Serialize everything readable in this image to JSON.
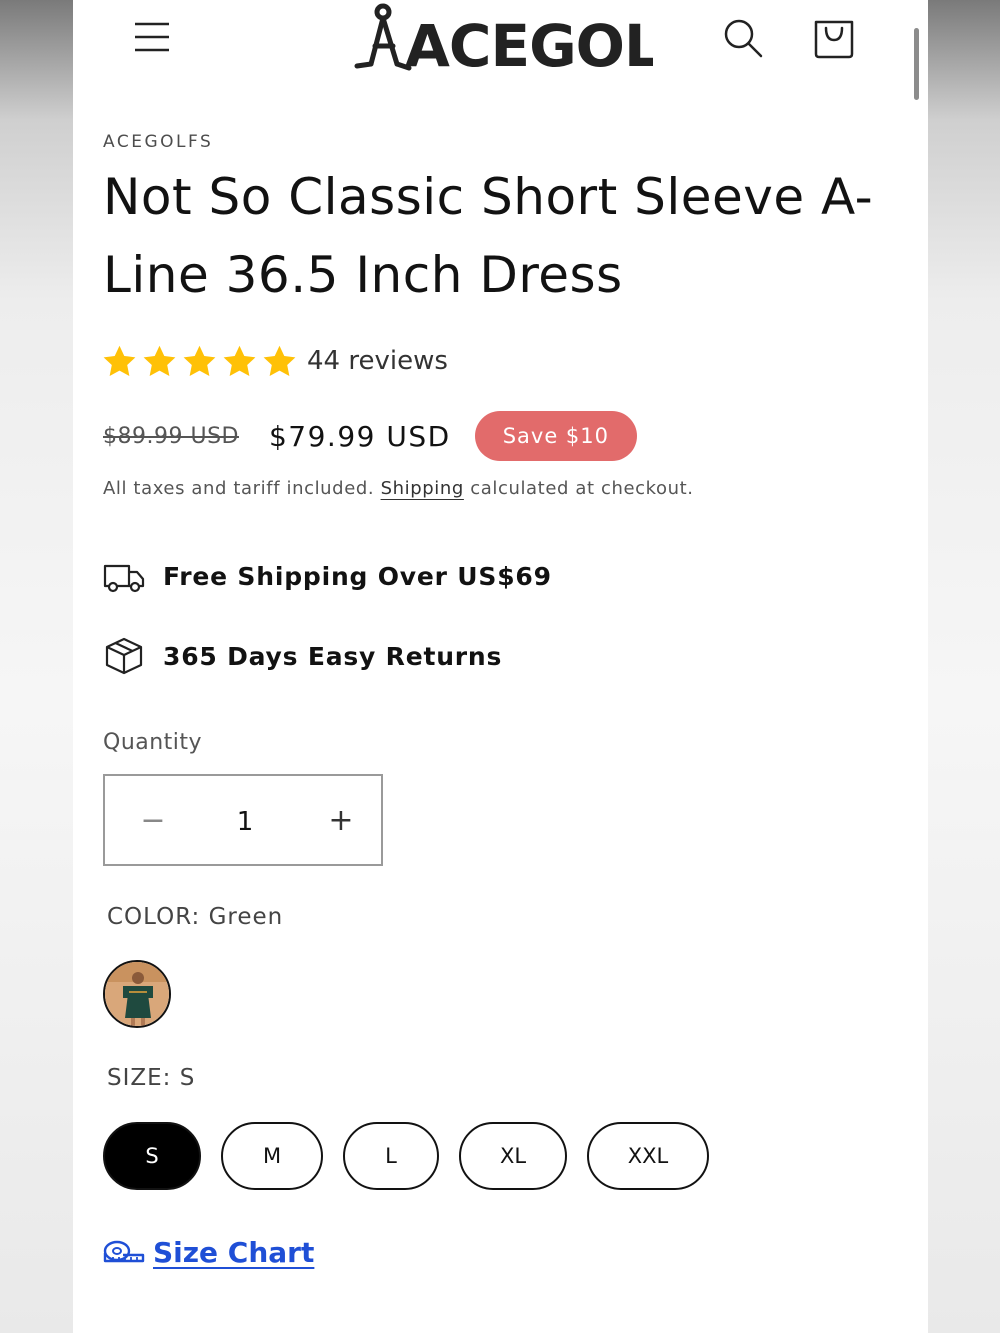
{
  "header": {
    "logo_text": "ACEGOLFS",
    "menu_icon": "hamburger-menu-icon",
    "search_icon": "search-icon",
    "cart_icon": "shopping-bag-icon"
  },
  "product": {
    "vendor": "ACEGOLFS",
    "title": "Not So Classic Short Sleeve A-Line 36.5 Inch Dress",
    "rating": {
      "stars": 5,
      "reviews_label": "44 reviews",
      "star_color": "#ffc107"
    },
    "price": {
      "compare_at": "$89.99 USD",
      "current": "$79.99 USD",
      "badge": "Save $10",
      "badge_color": "#e26b6b"
    },
    "tax_note": {
      "before": "All taxes and tariff included.",
      "link": "Shipping",
      "after": "calculated at checkout."
    }
  },
  "features": [
    {
      "icon": "delivery-truck-icon",
      "label": "Free Shipping Over US$69"
    },
    {
      "icon": "package-box-icon",
      "label": "365 Days Easy Returns"
    }
  ],
  "quantity": {
    "label": "Quantity",
    "value": "1",
    "minus": "−",
    "plus": "+"
  },
  "color": {
    "label": "COLOR: Green",
    "swatch": "green-dress-swatch"
  },
  "size": {
    "label": "SIZE: S",
    "options": [
      "S",
      "M",
      "L",
      "XL",
      "XXL"
    ],
    "selected": "S"
  },
  "size_chart": {
    "label": "Size Chart",
    "icon": "measuring-tape-icon",
    "link_color": "#1f4fd6"
  }
}
